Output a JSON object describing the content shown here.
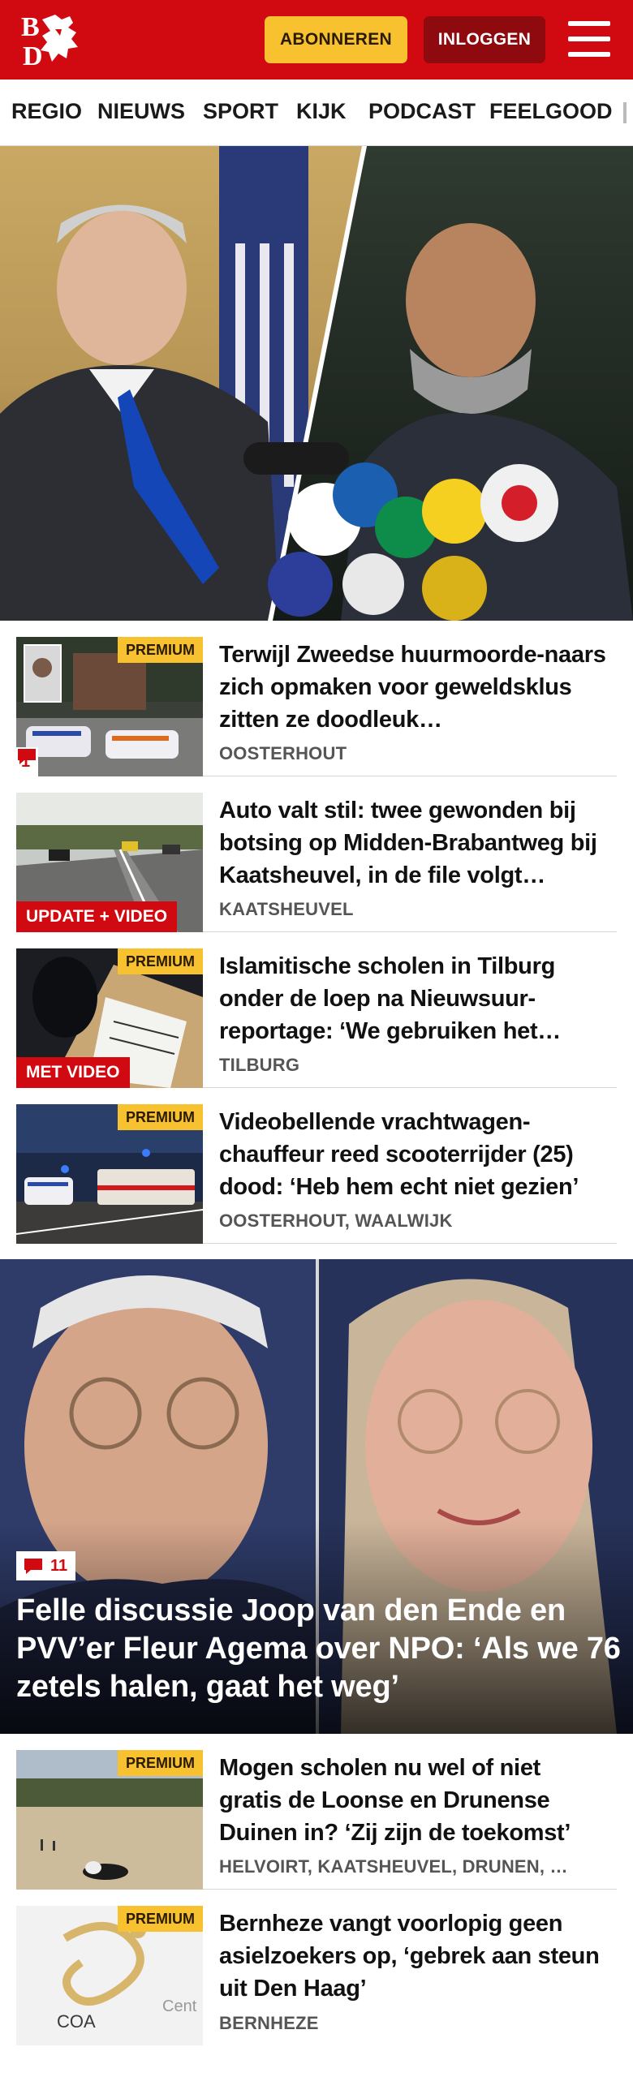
{
  "header": {
    "logo_text_top": "B",
    "logo_text_bottom": "D",
    "subscribe_label": "ABONNEREN",
    "login_label": "INLOGGEN",
    "colors": {
      "brand": "#d10a11",
      "accent": "#f7c12f",
      "login": "#8e0a0f"
    }
  },
  "nav": {
    "items": [
      "REGIO",
      "NIEUWS",
      "SPORT",
      "KIJK",
      "PODCAST",
      "FEELGOOD"
    ]
  },
  "articles": [
    {
      "premium": "PREMIUM",
      "comments": "1",
      "headline": "Terwijl Zweedse huurmoorde-naars zich opmaken voor geweldsklus zitten ze doodleuk…",
      "location": "OOSTERHOUT"
    },
    {
      "label": "UPDATE + VIDEO",
      "headline": "Auto valt stil: twee gewonden bij botsing op Midden-Brabantweg bij Kaatsheuvel, in de file volgt…",
      "location": "KAATSHEUVEL"
    },
    {
      "premium": "PREMIUM",
      "label": "MET VIDEO",
      "headline": "Islamitische scholen in Tilburg onder de loep na Nieuwsuur-reportage: ‘We gebruiken het…",
      "location": "TILBURG"
    },
    {
      "premium": "PREMIUM",
      "headline": "Videobellende vrachtwagen-chauffeur reed scooterrijder (25) dood: ‘Heb hem echt niet gezien’",
      "location": "OOSTERHOUT, WAALWIJK"
    }
  ],
  "feature": {
    "comments": "11",
    "headline": "Felle discussie Joop van den Ende en PVV’er Fleur Agema over NPO: ‘Als we 76 zetels halen, gaat het weg’"
  },
  "articles2": [
    {
      "premium": "PREMIUM",
      "headline": "Mogen scholen nu wel of niet gratis de Loonse en Drunense Duinen in? ‘Zij zijn de toekomst’",
      "location": "HELVOIRT, KAATSHEUVEL, DRUNEN, …"
    },
    {
      "premium": "PREMIUM",
      "thumb_text_1": "COA",
      "thumb_text_2": "Cent",
      "headline": "Bernheze vangt voorlopig geen asielzoekers op, ‘gebrek aan steun uit Den Haag’",
      "location": "BERNHEZE"
    }
  ]
}
